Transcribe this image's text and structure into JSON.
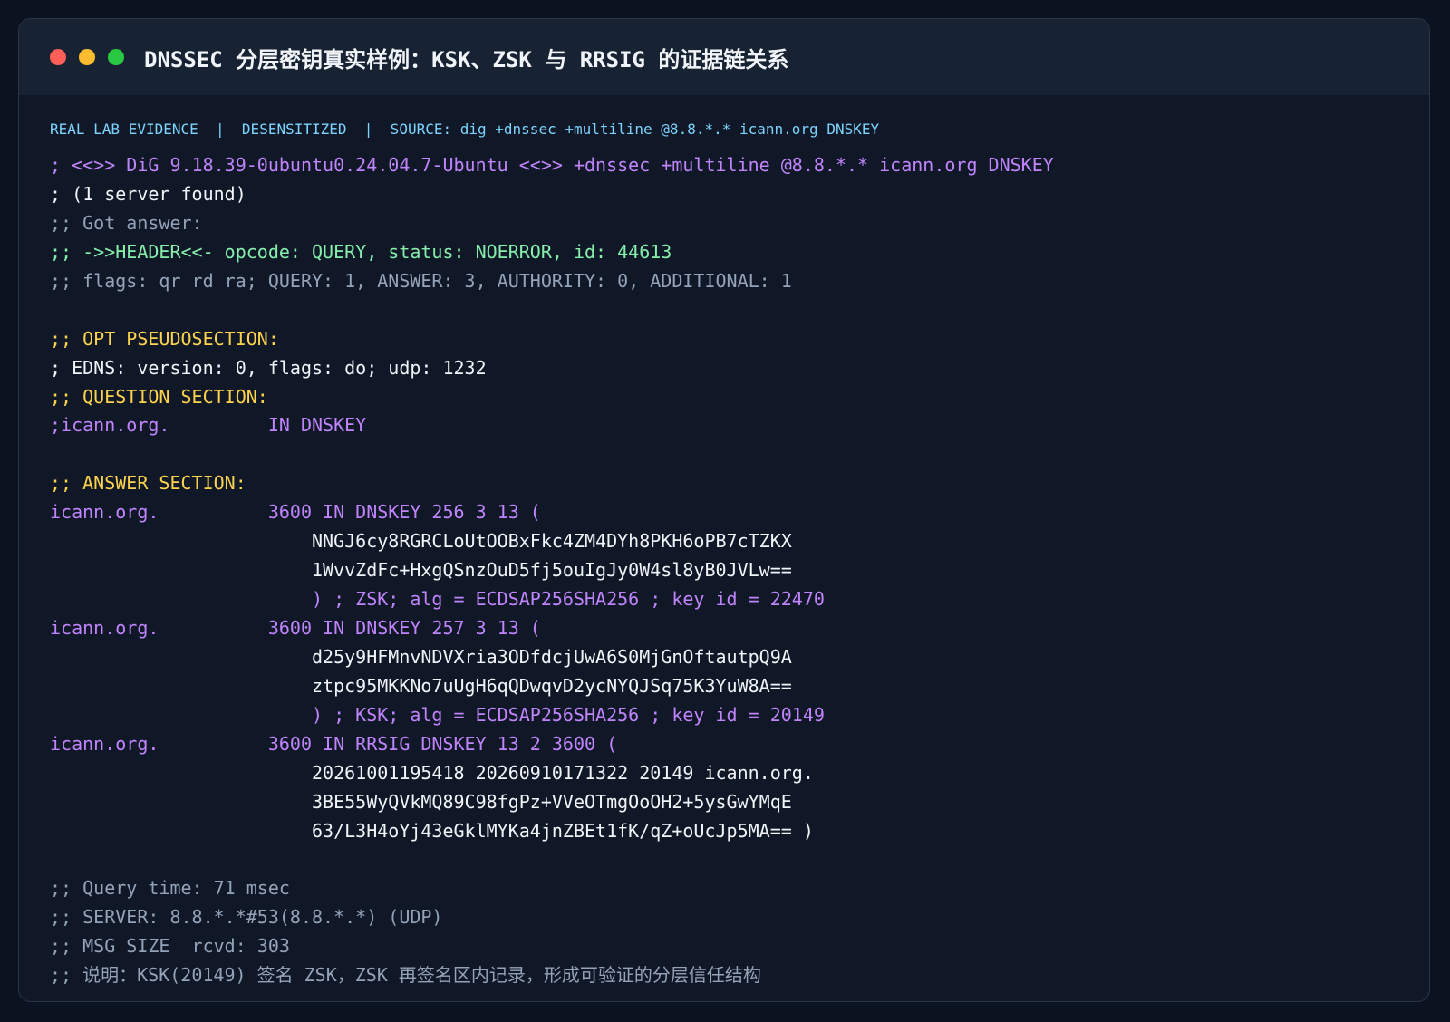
{
  "window": {
    "title": "DNSSEC 分层密钥真实样例：KSK、ZSK 与 RRSIG 的证据链关系",
    "controls": {
      "close_color": "#ff5f57",
      "minimize_color": "#febc2e",
      "maximize_color": "#28c840"
    }
  },
  "meta": {
    "text": "REAL LAB EVIDENCE  |  DESENSITIZED  |  SOURCE: dig +dnssec +multiline @8.8.*.* icann.org DNSKEY",
    "color": "#7dd3fc"
  },
  "colors": {
    "purple": "#c084fc",
    "white": "#f1f5f9",
    "gray": "#94a3b8",
    "green": "#86efac",
    "yellow": "#fcd34d"
  },
  "terminal": {
    "lines": [
      {
        "text": "; <<>> DiG 9.18.39-0ubuntu0.24.04.7-Ubuntu <<>> +dnssec +multiline @8.8.*.* icann.org DNSKEY",
        "color": "#c084fc"
      },
      {
        "text": "; (1 server found)",
        "color": "#f1f5f9"
      },
      {
        "text": ";; Got answer:",
        "color": "#94a3b8"
      },
      {
        "text": ";; ->>HEADER<<- opcode: QUERY, status: NOERROR, id: 44613",
        "color": "#86efac"
      },
      {
        "text": ";; flags: qr rd ra; QUERY: 1, ANSWER: 3, AUTHORITY: 0, ADDITIONAL: 1",
        "color": "#94a3b8"
      },
      {
        "text": "",
        "color": "#94a3b8"
      },
      {
        "text": ";; OPT PSEUDOSECTION:",
        "color": "#fcd34d"
      },
      {
        "text": "; EDNS: version: 0, flags: do; udp: 1232",
        "color": "#f1f5f9"
      },
      {
        "text": ";; QUESTION SECTION:",
        "color": "#fcd34d"
      },
      {
        "text": ";icann.org.         IN DNSKEY",
        "color": "#c084fc"
      },
      {
        "text": "",
        "color": "#94a3b8"
      },
      {
        "text": ";; ANSWER SECTION:",
        "color": "#fcd34d"
      },
      {
        "text": "icann.org.          3600 IN DNSKEY 256 3 13 (",
        "color": "#c084fc"
      },
      {
        "text": "                        NNGJ6cy8RGRCLoUtOOBxFkc4ZM4DYh8PKH6oPB7cTZKX",
        "color": "#f1f5f9"
      },
      {
        "text": "                        1WvvZdFc+HxgQSnzOuD5fj5ouIgJy0W4sl8yB0JVLw==",
        "color": "#f1f5f9"
      },
      {
        "text": "                        ) ; ZSK; alg = ECDSAP256SHA256 ; key id = 22470",
        "color": "#c084fc"
      },
      {
        "text": "icann.org.          3600 IN DNSKEY 257 3 13 (",
        "color": "#c084fc"
      },
      {
        "text": "                        d25y9HFMnvNDVXria3ODfdcjUwA6S0MjGnOftautpQ9A",
        "color": "#f1f5f9"
      },
      {
        "text": "                        ztpc95MKKNo7uUgH6qQDwqvD2ycNYQJSq75K3YuW8A==",
        "color": "#f1f5f9"
      },
      {
        "text": "                        ) ; KSK; alg = ECDSAP256SHA256 ; key id = 20149",
        "color": "#c084fc"
      },
      {
        "text": "icann.org.          3600 IN RRSIG DNSKEY 13 2 3600 (",
        "color": "#c084fc"
      },
      {
        "text": "                        20261001195418 20260910171322 20149 icann.org.",
        "color": "#f1f5f9"
      },
      {
        "text": "                        3BE55WyQVkMQ89C98fgPz+VVeOTmgOoOH2+5ysGwYMqE",
        "color": "#f1f5f9"
      },
      {
        "text": "                        63/L3H4oYj43eGklMYKa4jnZBEt1fK/qZ+oUcJp5MA== )",
        "color": "#f1f5f9"
      },
      {
        "text": "",
        "color": "#94a3b8"
      },
      {
        "text": ";; Query time: 71 msec",
        "color": "#94a3b8"
      },
      {
        "text": ";; SERVER: 8.8.*.*#53(8.8.*.*) (UDP)",
        "color": "#94a3b8"
      },
      {
        "text": ";; MSG SIZE  rcvd: 303",
        "color": "#94a3b8"
      },
      {
        "text": ";; 说明：KSK(20149) 签名 ZSK，ZSK 再签名区内记录，形成可验证的分层信任结构",
        "color": "#94a3b8"
      }
    ]
  }
}
